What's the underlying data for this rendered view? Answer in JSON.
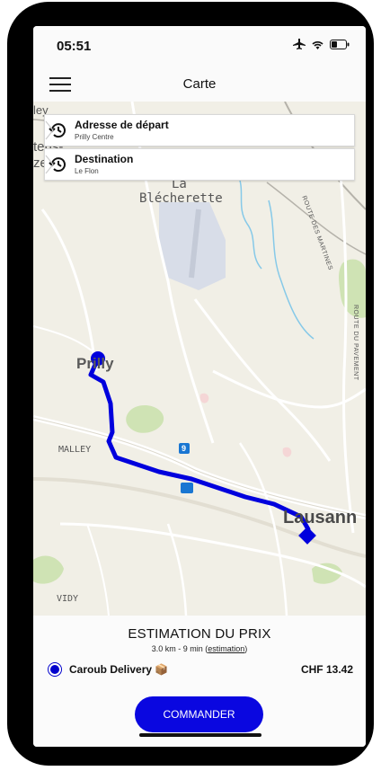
{
  "status_bar": {
    "time": "05:51"
  },
  "navbar": {
    "title": "Carte"
  },
  "route_inputs": {
    "departure": {
      "label": "Adresse de départ",
      "value": "Prilly Centre"
    },
    "destination": {
      "label": "Destination",
      "value": "Le Flon"
    }
  },
  "map": {
    "labels": {
      "blecherette_1": "La",
      "blecherette_2": "Blécherette",
      "prilly": "Prilly",
      "malley": "MALLEY",
      "lausanne": "Lausann",
      "vidy": "VIDY",
      "route_martines": "ROUTE DES MARTINES",
      "route_pavement": "ROUTE DU PAVEMENT",
      "marker_9": "9",
      "cut_top": "ley",
      "cut_left_1": "tens-",
      "cut_left_2": "ze"
    },
    "route_color": "#0000dd"
  },
  "estimate": {
    "title": "ESTIMATION DU PRIX",
    "summary": "3.0 km - 9 min (",
    "link": "estimation",
    "summary_end": ")"
  },
  "service": {
    "name": "Caroub Delivery 📦",
    "price": "CHF 13.42",
    "selected": true
  },
  "order_button": {
    "label": "COMMANDER"
  },
  "colors": {
    "accent": "#0a07e0",
    "map_bg": "#f1efe6"
  }
}
